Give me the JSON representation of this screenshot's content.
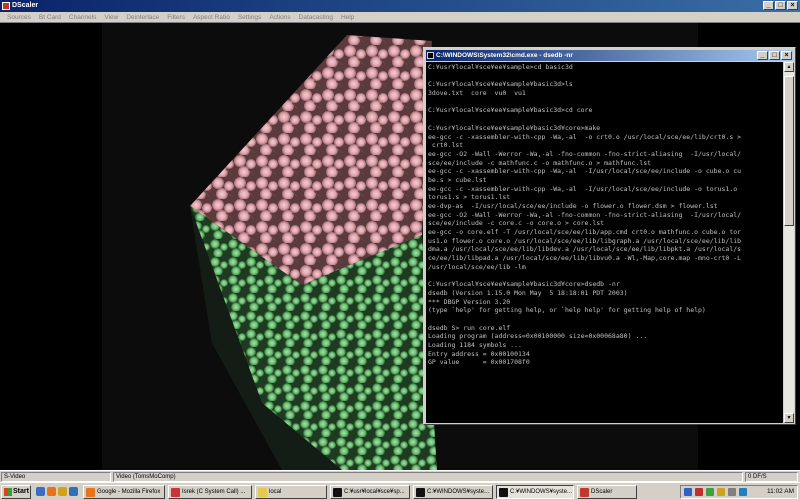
{
  "dscaler": {
    "title": "DScaler",
    "menu": [
      "Sources",
      "Bt Card",
      "Channels",
      "View",
      "Deinterlace",
      "Filters",
      "Aspect Ratio",
      "Settings",
      "Actions",
      "Datacasting",
      "Help"
    ],
    "status": {
      "source": "S-Video",
      "mode": "Video (TomsMoComp)",
      "fps": "0 DF/S"
    }
  },
  "cmd": {
    "title": "C:\\WINDOWS\\System32\\cmd.exe - dsedb -nr",
    "lines": [
      "C:¥usr¥local¥sce¥ee¥sample>cd basic3d",
      "",
      "C:¥usr¥local¥sce¥ee¥sample¥basic3d>ls",
      "3dove.txt  core  vu0  vu1",
      "",
      "C:¥usr¥local¥sce¥ee¥sample¥basic3d>cd core",
      "",
      "C:¥usr¥local¥sce¥ee¥sample¥basic3d¥core>make",
      "ee-gcc -c -xassembler-with-cpp -Wa,-al  -o crt0.o /usr/local/sce/ee/lib/crt0.s >",
      " crt0.lst",
      "ee-gcc -O2 -Wall -Werror -Wa,-al -fno-common -fno-strict-aliasing  -I/usr/local/",
      "sce/ee/include -c mathfunc.c -o mathfunc.o > mathfunc.lst",
      "ee-gcc -c -xassembler-with-cpp -Wa,-al  -I/usr/local/sce/ee/include -o cube.o cu",
      "be.s > cube.lst",
      "ee-gcc -c -xassembler-with-cpp -Wa,-al  -I/usr/local/sce/ee/include -o torus1.o",
      "torus1.s > torus1.lst",
      "ee-dvp-as  -I/usr/local/sce/ee/include -o flower.o flower.dsm > flower.lst",
      "ee-gcc -O2 -Wall -Werror -Wa,-al -fno-common -fno-strict-aliasing  -I/usr/local/",
      "sce/ee/include -c core.c -o core.o > core.lst",
      "ee-gcc -o core.elf -T /usr/local/sce/ee/lib/app.cmd crt0.o mathfunc.o cube.o tor",
      "us1.o flower.o core.o /usr/local/sce/ee/lib/libgraph.a /usr/local/sce/ee/lib/lib",
      "dma.a /usr/local/sce/ee/lib/libdev.a /usr/local/sce/ee/lib/libpkt.a /usr/local/s",
      "ce/ee/lib/libpad.a /usr/local/sce/ee/lib/libvu0.a -Wl,-Map,core.map -mno-crt0 -L",
      "/usr/local/sce/ee/lib -lm",
      "",
      "C:¥usr¥local¥sce¥ee¥sample¥basic3d¥core>dsedb -nr",
      "dsedb (Version 1.15.0 Mon May  5 18:18:01 PDT 2003)",
      "*** DBGP Version 3.20",
      "(type `help' for getting help, or `help help' for getting help of help)",
      "",
      "dsedb S> run core.elf",
      "Loading program (address=0x00100000 size=0x00068a80) ...",
      "Loading 1184 symbols ...",
      "Entry address = 0x00100134",
      "GP value      = 0x001708f0"
    ]
  },
  "taskbar": {
    "start_label": "Start",
    "tasks": [
      {
        "label": "Google - Mozilla Firefox",
        "icon_color": "#e8731a",
        "active": false
      },
      {
        "label": "Isrek (C System Call) ...",
        "icon_color": "#cc3333",
        "active": false
      },
      {
        "label": "local",
        "icon_color": "#e8c84a",
        "active": false
      },
      {
        "label": "C:¥usr¥local¥sce¥sp...",
        "icon_color": "#111111",
        "active": false
      },
      {
        "label": "C:¥WINDOWS¥syste...",
        "icon_color": "#111111",
        "active": false
      },
      {
        "label": "C:¥WINDOWS¥syste...",
        "icon_color": "#111111",
        "active": true
      },
      {
        "label": "DScaler",
        "icon_color": "#c0392b",
        "active": false
      }
    ],
    "clock": "11:02 AM"
  }
}
